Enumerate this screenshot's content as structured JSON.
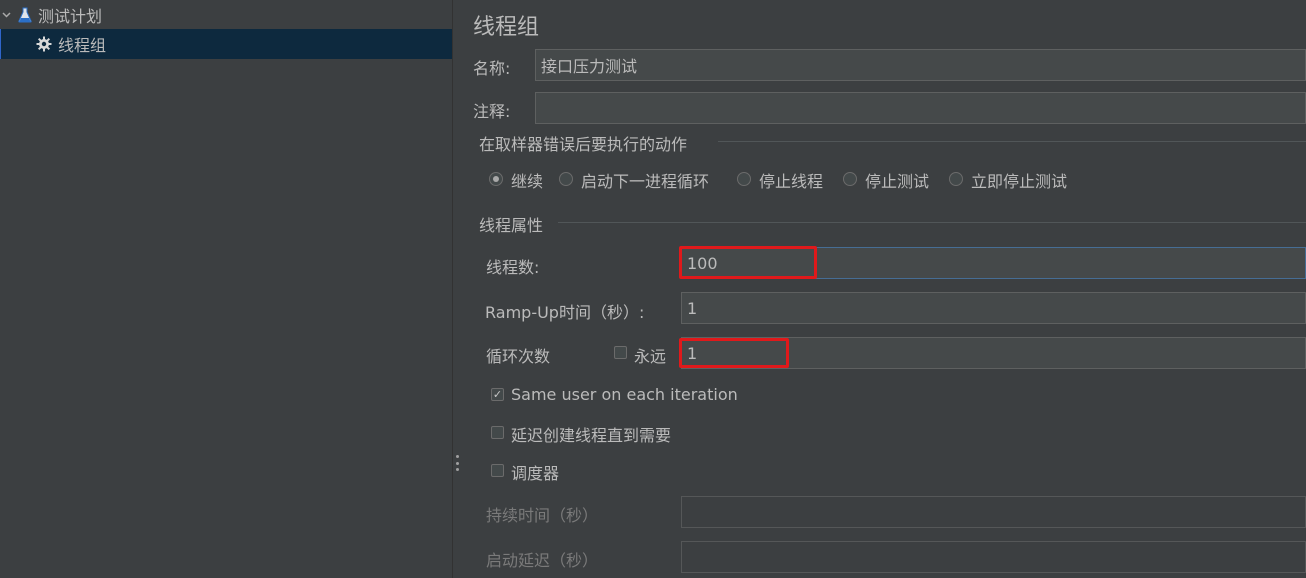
{
  "tree": {
    "root_label": "测试计划",
    "child_label": "线程组"
  },
  "form": {
    "title": "线程组",
    "name_label": "名称:",
    "name_value": "接口压力测试",
    "comment_label": "注释:",
    "comment_value": "",
    "on_error_section": "在取样器错误后要执行的动作",
    "on_error_options": [
      "继续",
      "启动下一进程循环",
      "停止线程",
      "停止测试",
      "立即停止测试"
    ],
    "on_error_selected": 0,
    "thread_props_section": "线程属性",
    "threads_label": "线程数:",
    "threads_value": "100",
    "rampup_label": "Ramp-Up时间（秒）:",
    "rampup_value": "1",
    "loop_label": "循环次数",
    "loop_forever_label": "永远",
    "loop_forever_checked": false,
    "loop_value": "1",
    "same_user_label": "Same user on each iteration",
    "same_user_checked": true,
    "delay_label": "延迟创建线程直到需要",
    "delay_checked": false,
    "scheduler_label": "调度器",
    "scheduler_checked": false,
    "duration_label": "持续时间（秒）",
    "duration_value": "",
    "startup_delay_label": "启动延迟（秒）",
    "startup_delay_value": ""
  },
  "colors": {
    "background": "#3c3f41",
    "selection": "#0d293e",
    "highlight_box": "#e0191b"
  }
}
